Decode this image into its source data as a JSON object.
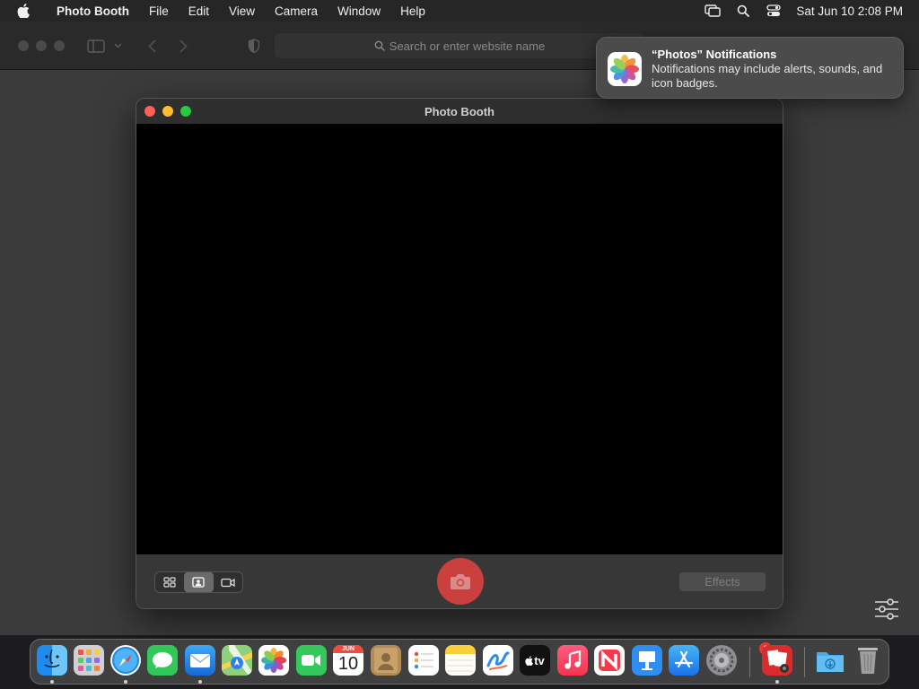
{
  "menubar": {
    "app_name": "Photo Booth",
    "items": [
      "File",
      "Edit",
      "View",
      "Camera",
      "Window",
      "Help"
    ],
    "clock": "Sat Jun 10  2:08 PM"
  },
  "browser": {
    "address_placeholder": "Search or enter website name"
  },
  "window": {
    "title": "Photo Booth",
    "effects_label": "Effects"
  },
  "notification": {
    "title": "“Photos” Notifications",
    "body": "Notifications may include alerts, sounds, and icon badges."
  },
  "dock": {
    "calendar_month": "JUN",
    "calendar_day": "10",
    "tv_label": "tv",
    "settings_badge": "1"
  }
}
